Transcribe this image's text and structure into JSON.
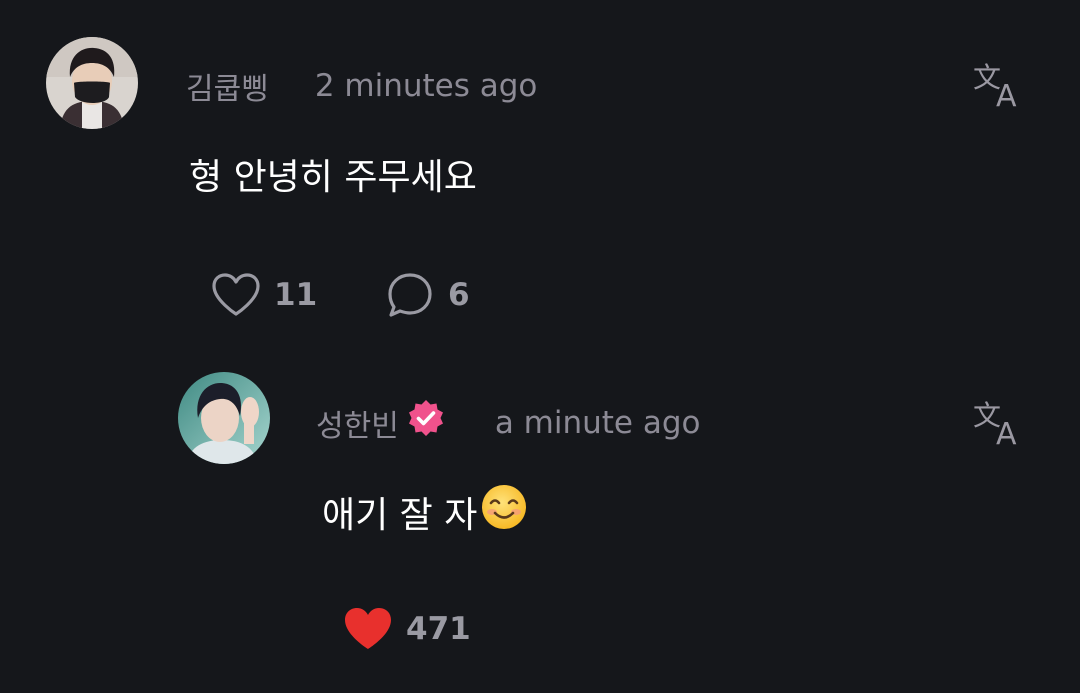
{
  "comment": {
    "username": "김쿱삥",
    "time": "2 minutes ago",
    "text": "형 안녕히 주무세요",
    "likes": "11",
    "replies": "6",
    "liked": false
  },
  "reply": {
    "username": "성한빈",
    "verified": true,
    "time": "a minute ago",
    "text": "애기 잘 자",
    "emoji": "smiling-face-emoji",
    "likes": "471",
    "liked": true
  },
  "colors": {
    "background": "#15171b",
    "muted_text": "#8c8a95",
    "heart_red": "#e8302d",
    "verified_pink": "#f0528c"
  },
  "icons": {
    "translate": "translate-icon",
    "like_outline": "heart-outline-icon",
    "like_filled": "heart-filled-icon",
    "reply": "comment-bubble-icon",
    "verified": "verified-badge-icon"
  }
}
